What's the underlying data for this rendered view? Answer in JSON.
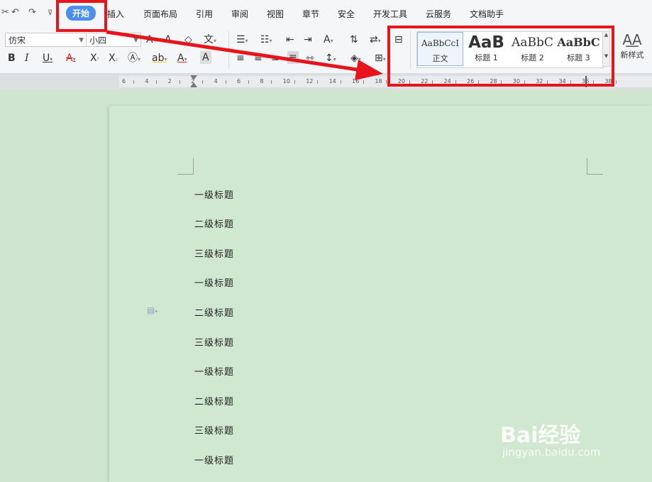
{
  "menu": {
    "tabs": [
      "开始",
      "插入",
      "页面布局",
      "引用",
      "审阅",
      "视图",
      "章节",
      "安全",
      "开发工具",
      "云服务",
      "文档助手"
    ]
  },
  "ribbon": {
    "font_name": "仿宋",
    "font_size": "小四",
    "styles": [
      {
        "preview": "AaBbCcI",
        "caption": "正文"
      },
      {
        "preview": "AaB",
        "caption": "标题 1"
      },
      {
        "preview": "AaBbC",
        "caption": "标题 2"
      },
      {
        "preview": "AaBbC",
        "caption": "标题 3"
      }
    ],
    "new_style": "新样式"
  },
  "ruler": {
    "labels": [
      "6",
      "4",
      "2",
      "2",
      "4",
      "6",
      "8",
      "10",
      "12",
      "14",
      "16",
      "18",
      "20",
      "22",
      "24",
      "26",
      "28",
      "30",
      "32",
      "34",
      "36",
      "38"
    ]
  },
  "document": {
    "lines": [
      "一级标题",
      "二级标题",
      "三级标题",
      "一级标题",
      "二级标题",
      "三级标题",
      "一级标题",
      "二级标题",
      "三级标题",
      "一级标题"
    ]
  },
  "watermark": {
    "brand": "Bai经验",
    "url": "jingyan.baidu.com"
  },
  "colors": {
    "annotation": "#e8141c",
    "active_tab": "#4a8ff0",
    "page": "#d0e8cf"
  }
}
